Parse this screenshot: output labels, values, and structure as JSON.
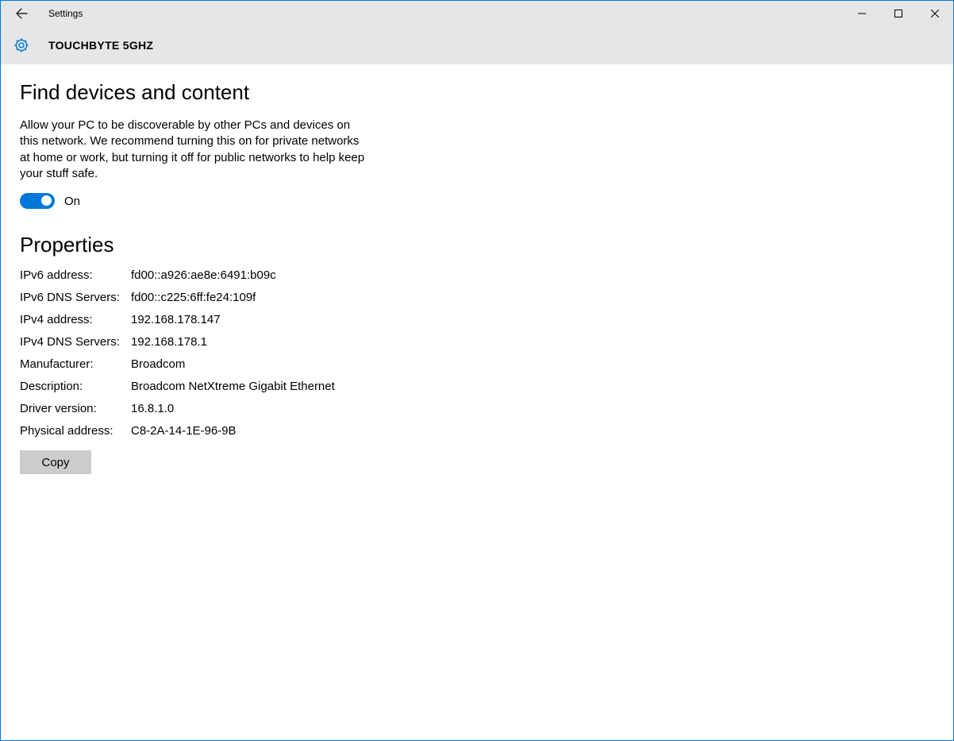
{
  "window": {
    "title": "Settings",
    "network_name": "TOUCHBYTE 5GHZ"
  },
  "find_devices": {
    "heading": "Find devices and content",
    "description": "Allow your PC to be discoverable by other PCs and devices on this network. We recommend turning this on for private networks at home or work, but turning it off for public networks to help keep your stuff safe.",
    "toggle_state_label": "On"
  },
  "properties": {
    "heading": "Properties",
    "items": [
      {
        "label": "IPv6 address:",
        "value": "fd00::a926:ae8e:6491:b09c"
      },
      {
        "label": "IPv6 DNS Servers:",
        "value": "fd00::c225:6ff:fe24:109f"
      },
      {
        "label": "IPv4 address:",
        "value": "192.168.178.147"
      },
      {
        "label": "IPv4 DNS Servers:",
        "value": "192.168.178.1"
      },
      {
        "label": "Manufacturer:",
        "value": "Broadcom"
      },
      {
        "label": "Description:",
        "value": "Broadcom NetXtreme Gigabit Ethernet"
      },
      {
        "label": "Driver version:",
        "value": "16.8.1.0"
      },
      {
        "label": "Physical address:",
        "value": "C8-2A-14-1E-96-9B"
      }
    ],
    "copy_label": "Copy"
  },
  "colors": {
    "accent": "#0078d7",
    "header_bg": "#e6e6e6",
    "button_bg": "#cccccc"
  }
}
